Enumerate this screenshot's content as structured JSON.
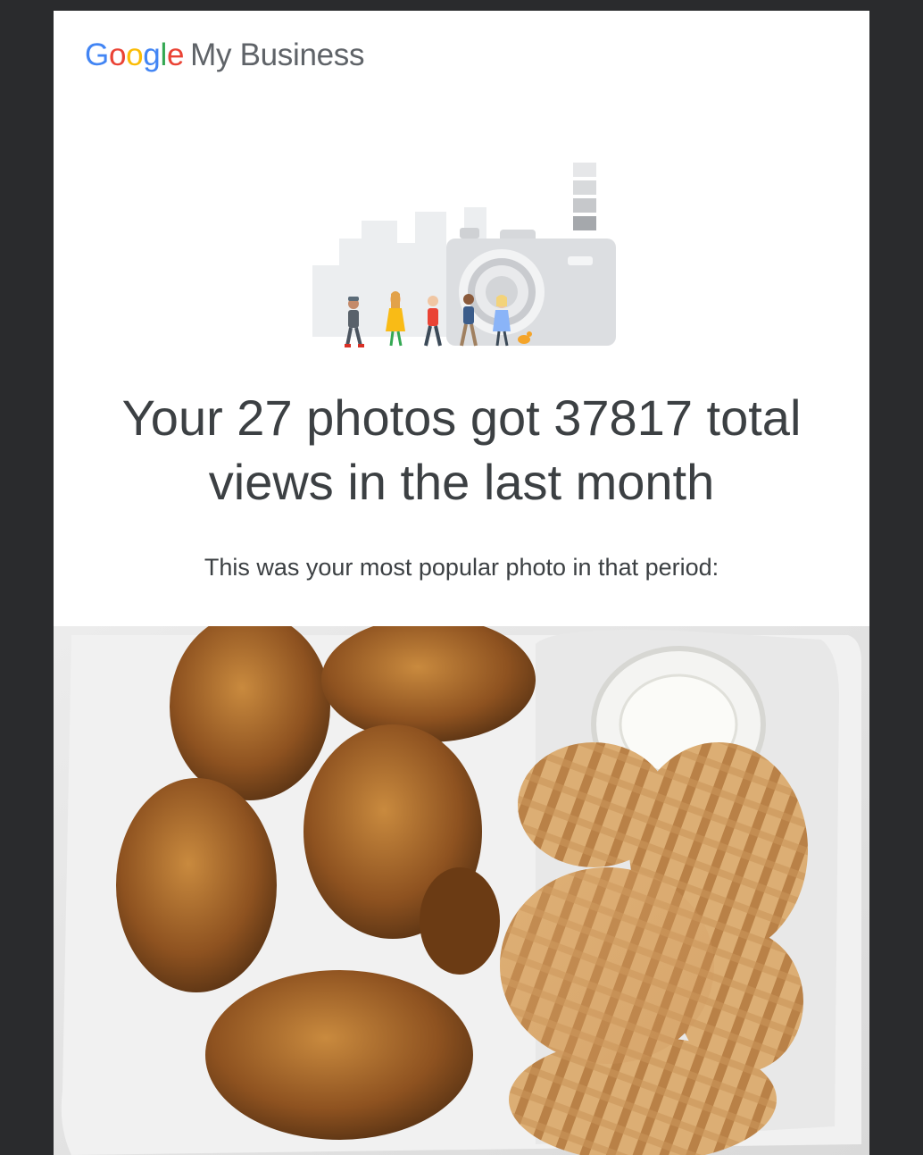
{
  "brand": {
    "g1": "G",
    "g2": "o",
    "g3": "o",
    "g4": "g",
    "g5": "l",
    "g6": "e",
    "product": "My Business"
  },
  "hero": {
    "icon": "camera-with-people-illustration"
  },
  "summary": {
    "headline_line1": "Your 27 photos got 37817 total",
    "headline_line2": "views in the last month",
    "subline": "This was your most popular photo in that period:"
  },
  "popular_photo": {
    "subject": "chicken wings and waffle fries in a foam takeout container"
  },
  "colors": {
    "background": "#2a2b2d",
    "card": "#ffffff",
    "text": "#3c4043",
    "google_blue": "#4285f4",
    "google_red": "#ea4335",
    "google_yellow": "#fbbc05",
    "google_green": "#34a853"
  }
}
